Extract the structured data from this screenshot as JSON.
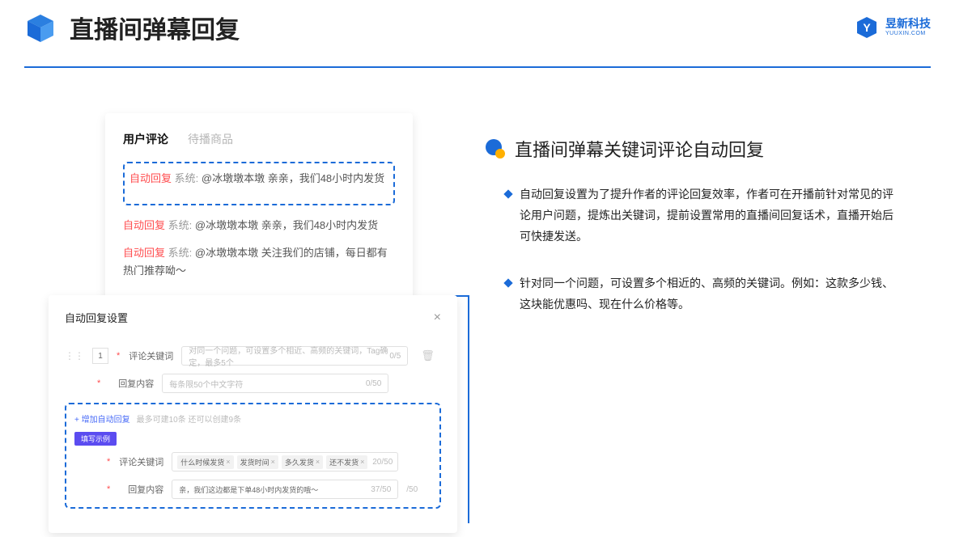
{
  "header": {
    "title": "直播间弹幕回复",
    "brand_cn": "昱新科技",
    "brand_en": "YUUXIN.COM"
  },
  "card_top": {
    "tab1": "用户评论",
    "tab2": "待播商品",
    "r1_badge": "自动回复",
    "r1_sys": "系统:",
    "r1_text": "@冰墩墩本墩 亲亲，我们48小时内发货",
    "r2_badge": "自动回复",
    "r2_sys": "系统:",
    "r2_text": "@冰墩墩本墩 亲亲，我们48小时内发货",
    "r3_badge": "自动回复",
    "r3_sys": "系统:",
    "r3_text": "@冰墩墩本墩 关注我们的店铺，每日都有热门推荐呦～"
  },
  "card_bottom": {
    "title": "自动回复设置",
    "idx": "1",
    "label_keyword": "评论关键词",
    "placeholder_keyword": "对同一个问题，可设置多个相近、高频的关键词，Tag确定，最多5个",
    "counter_keyword": "0/5",
    "label_content": "回复内容",
    "placeholder_content": "每条限50个中文字符",
    "counter_content": "0/50",
    "add_label": "+ 增加自动回复",
    "add_hint": "最多可建10条 还可以创建9条",
    "example_badge": "填写示例",
    "ex_label_keyword": "评论关键词",
    "ex_tag1": "什么时候发货",
    "ex_tag2": "发货时间",
    "ex_tag3": "多久发货",
    "ex_tag4": "还不发货",
    "ex_counter_keyword": "20/50",
    "ex_label_content": "回复内容",
    "ex_content": "亲，我们这边都是下单48小时内发货的哦～",
    "ex_counter_content": "37/50",
    "outer_counter": "/50"
  },
  "right": {
    "section_title": "直播间弹幕关键词评论自动回复",
    "bullet1": "自动回复设置为了提升作者的评论回复效率，作者可在开播前针对常见的评论用户问题，提炼出关键词，提前设置常用的直播间回复话术，直播开始后可快捷发送。",
    "bullet2": "针对同一个问题，可设置多个相近的、高频的关键词。例如：这款多少钱、这块能优惠吗、现在什么价格等。"
  }
}
